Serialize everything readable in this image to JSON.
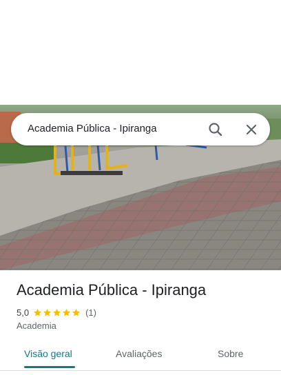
{
  "search": {
    "query": "Academia Pública - Ipiranga"
  },
  "icons": {
    "search": "search-icon",
    "close": "close-icon",
    "star": "star-icon"
  },
  "place": {
    "name": "Academia Pública - Ipiranga",
    "rating": "5,0",
    "stars": 5,
    "review_count": "(1)",
    "category": "Academia"
  },
  "tabs": [
    {
      "label": "Visão geral",
      "active": true
    },
    {
      "label": "Avaliações",
      "active": false
    },
    {
      "label": "Sobre",
      "active": false
    }
  ],
  "colors": {
    "accent": "#0a7c86",
    "star": "#fbbc04",
    "text": "#202124",
    "secondary": "#5f6368"
  }
}
